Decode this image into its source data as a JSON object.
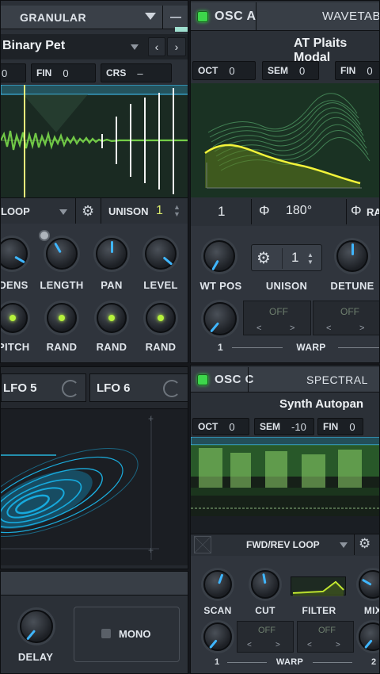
{
  "granular": {
    "mode": "GRANULAR",
    "preset": "Binary Pet",
    "fin_label": "FIN",
    "fin_value": "0",
    "crs_label": "CRS",
    "crs_value": "–",
    "loop_mode": "LOOP",
    "unison_label": "UNISON",
    "unison_value": "1",
    "knobs_top": [
      "DENS",
      "LENGTH",
      "PAN",
      "LEVEL"
    ],
    "knobs_bottom": [
      "PITCH",
      "RAND",
      "RAND",
      "RAND"
    ]
  },
  "osc_a": {
    "title": "OSC A",
    "type": "WAVETABLE",
    "preset": "AT Plaits Modal",
    "oct_label": "OCT",
    "oct_value": "0",
    "sem_label": "SEM",
    "sem_value": "0",
    "fin_label": "FIN",
    "fin_value": "0",
    "wt_frame": "1",
    "phase_value": "180°",
    "rand_label": "RA",
    "wt_pos_label": "WT POS",
    "unison_label": "UNISON",
    "unison_value": "1",
    "detune_label": "DETUNE",
    "warp_off_1": "OFF",
    "warp_off_2": "OFF",
    "warp_num": "1",
    "warp_label": "WARP"
  },
  "lfo": {
    "lfo5": "LFO 5",
    "lfo6": "LFO 6"
  },
  "fx": {
    "delay_label": "DELAY",
    "mono_label": "MONO"
  },
  "osc_c": {
    "title": "OSC C",
    "type": "SPECTRAL",
    "preset": "Synth Autopan",
    "oct_label": "OCT",
    "oct_value": "0",
    "sem_label": "SEM",
    "sem_value": "-10",
    "fin_label": "FIN",
    "fin_value": "0",
    "loop_mode": "FWD/REV LOOP",
    "scan_label": "SCAN",
    "cut_label": "CUT",
    "filter_label": "FILTER",
    "mix_label": "MIX",
    "warp_off_1": "OFF",
    "warp_off_2": "OFF",
    "warp_num_1": "1",
    "warp_label": "WARP",
    "warp_num_2": "2"
  },
  "colors": {
    "accent_green": "#3dd64b",
    "accent_blue": "#3fb6ff",
    "wave_yellow": "#e6ff35",
    "lfo_cyan": "#19c8ff"
  }
}
